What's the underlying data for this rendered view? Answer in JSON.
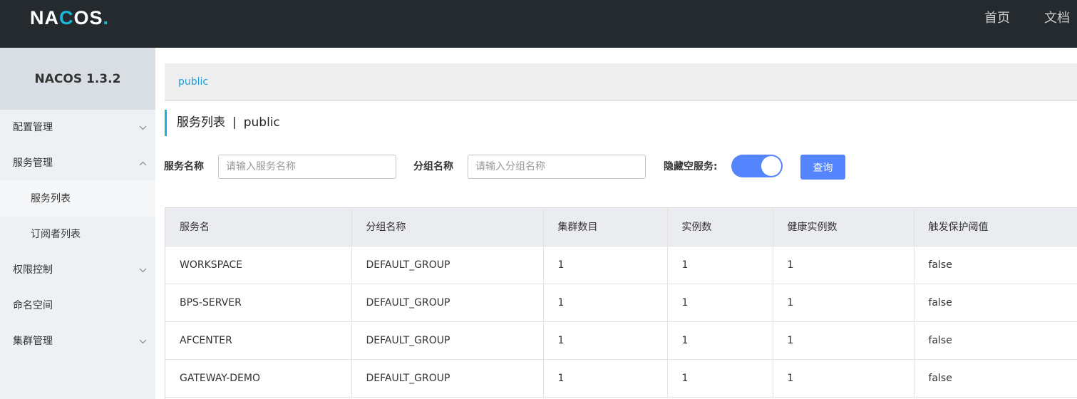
{
  "header": {
    "logo": {
      "n": "NA",
      "ring": "C",
      "rest": "OS",
      "dot": "."
    },
    "nav": [
      "首页",
      "文档"
    ]
  },
  "sidebar": {
    "title": "NACOS 1.3.2",
    "items": [
      {
        "label": "配置管理",
        "chevron": "chevron-down"
      },
      {
        "label": "服务管理",
        "chevron": "chevron-up"
      },
      {
        "label": "服务列表",
        "sub": true,
        "active": true
      },
      {
        "label": "订阅者列表",
        "sub": true
      },
      {
        "label": "权限控制",
        "chevron": "chevron-down"
      },
      {
        "label": "命名空间"
      },
      {
        "label": "集群管理",
        "chevron": "chevron-down"
      }
    ]
  },
  "breadcrumb": {
    "namespace": "public"
  },
  "page": {
    "title": "服务列表",
    "separator": "|",
    "namespace": "public"
  },
  "filters": {
    "service_name_label": "服务名称",
    "service_name_placeholder": "请输入服务名称",
    "group_name_label": "分组名称",
    "group_name_placeholder": "请输入分组名称",
    "hide_empty_label": "隐藏空服务:",
    "hide_empty_on": true,
    "query_label": "查询"
  },
  "table": {
    "columns": [
      "服务名",
      "分组名称",
      "集群数目",
      "实例数",
      "健康实例数",
      "触发保护阈值"
    ],
    "rows": [
      [
        "WORKSPACE",
        "DEFAULT_GROUP",
        "1",
        "1",
        "1",
        "false"
      ],
      [
        "BPS-SERVER",
        "DEFAULT_GROUP",
        "1",
        "1",
        "1",
        "false"
      ],
      [
        "AFCENTER",
        "DEFAULT_GROUP",
        "1",
        "1",
        "1",
        "false"
      ],
      [
        "GATEWAY-DEMO",
        "DEFAULT_GROUP",
        "1",
        "1",
        "1",
        "false"
      ]
    ]
  },
  "colors": {
    "topbar": "#252a2f",
    "accent": "#5584ff",
    "link": "#1aa3d8"
  }
}
